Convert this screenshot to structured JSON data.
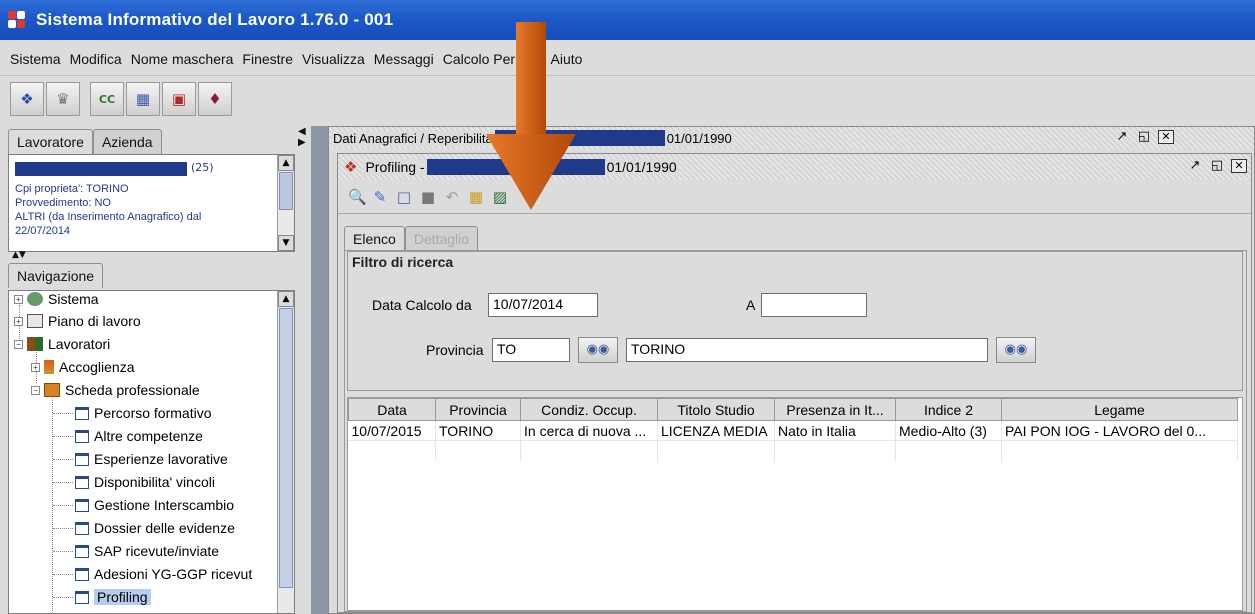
{
  "window": {
    "title": "Sistema Informativo del Lavoro 1.76.0 - 001"
  },
  "menu": [
    "Sistema",
    "Modifica",
    "Nome maschera",
    "Finestre",
    "Visualizza",
    "Messaggi",
    "Calcolo Periodo",
    "Aiuto"
  ],
  "left_panel": {
    "top_tabs": [
      "Lavoratore",
      "Azienda"
    ],
    "info": {
      "count": "(25)",
      "line1": "Cpi proprieta': TORINO",
      "line2": "Provvedimento: NO",
      "line3": "ALTRI (da Inserimento Anagrafico) dal",
      "line4": "22/07/2014"
    },
    "nav_tab": "Navigazione",
    "tree": {
      "sistema": "Sistema",
      "piano": "Piano di lavoro",
      "lavoratori": "Lavoratori",
      "accoglienza": "Accoglienza",
      "scheda": "Scheda professionale",
      "items": [
        "Percorso formativo",
        "Altre competenze",
        "Esperienze lavorative",
        "Disponibilita' vincoli",
        "Gestione Interscambio",
        "Dossier delle evidenze",
        "SAP ricevute/inviate",
        "Adesioni YG-GGP ricevut",
        "Profiling"
      ]
    }
  },
  "outer_frame": {
    "title": "Dati Anagrafici / Reperibilita",
    "date": "01/01/1990"
  },
  "profiling_frame": {
    "title": "Profiling - ",
    "date": "01/01/1990",
    "tabs": [
      "Elenco",
      "Dettaglio"
    ]
  },
  "filtro": {
    "legend": "Filtro di ricerca",
    "data_calcolo_label": "Data Calcolo da",
    "data_calcolo_value": "10/07/2014",
    "a_label": "A",
    "a_value": "",
    "provincia_label": "Provincia",
    "provincia_code": "TO",
    "provincia_name": "TORINO"
  },
  "grid": {
    "columns": [
      "Data",
      "Provincia",
      "Condiz. Occup.",
      "Titolo Studio",
      "Presenza in It...",
      "Indice 2",
      "Legame"
    ],
    "rows": [
      [
        "10/07/2015",
        "TORINO",
        "In cerca di nuova ...",
        "LICENZA MEDIA",
        "Nato in Italia",
        "Medio-Alto (3)",
        "PAI PON IOG - LAVORO del 0..."
      ]
    ]
  },
  "colors": {
    "titlebar": "#1d59c8",
    "redacted": "#1f3a8a",
    "arrow": "#c85a10"
  }
}
